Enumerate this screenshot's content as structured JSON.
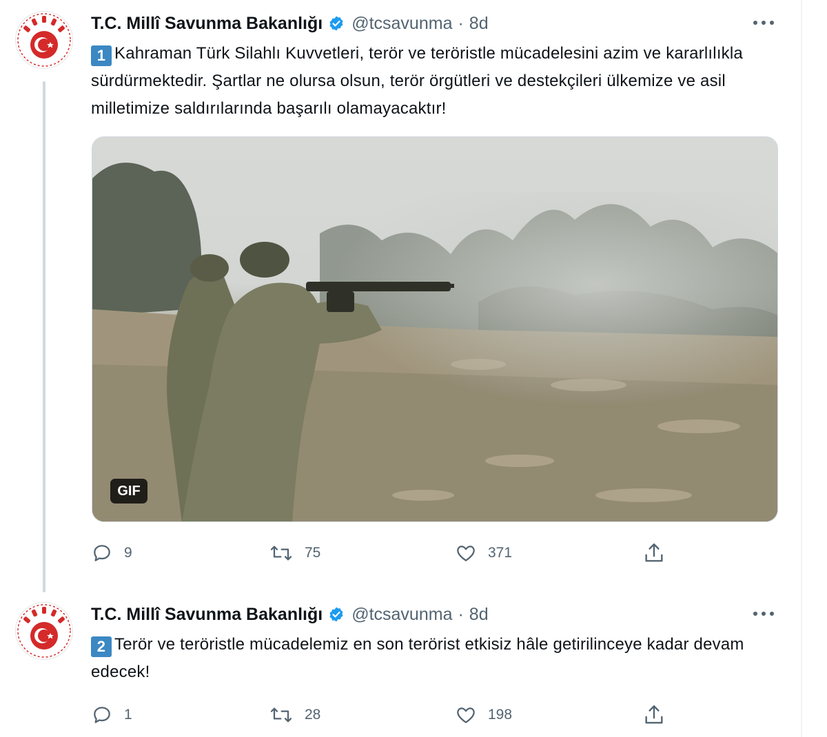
{
  "tweets": [
    {
      "author_name": "T.C. Millî Savunma Bakanlığı",
      "handle": "@tcsavunma",
      "separator": "·",
      "time": "8d",
      "number": "1",
      "text": "Kahraman Türk Silahlı Kuvvetleri, terör ve teröristle mücadelesini azim ve kararlılıkla sürdürmektedir. Şartlar ne olursa olsun, terör örgütleri ve destekçileri ülkemize ve asil milletimize saldırılarında başarılı olamayacaktır!",
      "media_badge": "GIF",
      "replies": "9",
      "retweets": "75",
      "likes": "371"
    },
    {
      "author_name": "T.C. Millî Savunma Bakanlığı",
      "handle": "@tcsavunma",
      "separator": "·",
      "time": "8d",
      "number": "2",
      "text": "Terör ve teröristle mücadelemiz en son terörist etkisiz hâle getirilinceye kadar devam edecek!",
      "replies": "1",
      "retweets": "28",
      "likes": "198"
    }
  ],
  "colors": {
    "verified_badge": "#1d9bf0",
    "logo_red": "#d42a2a",
    "keycap_blue": "#3b88c3",
    "muted_text": "#536471"
  },
  "icons": [
    "verified-badge-icon",
    "more-icon",
    "reply-icon",
    "retweet-icon",
    "like-icon",
    "share-icon",
    "ministry-logo"
  ]
}
